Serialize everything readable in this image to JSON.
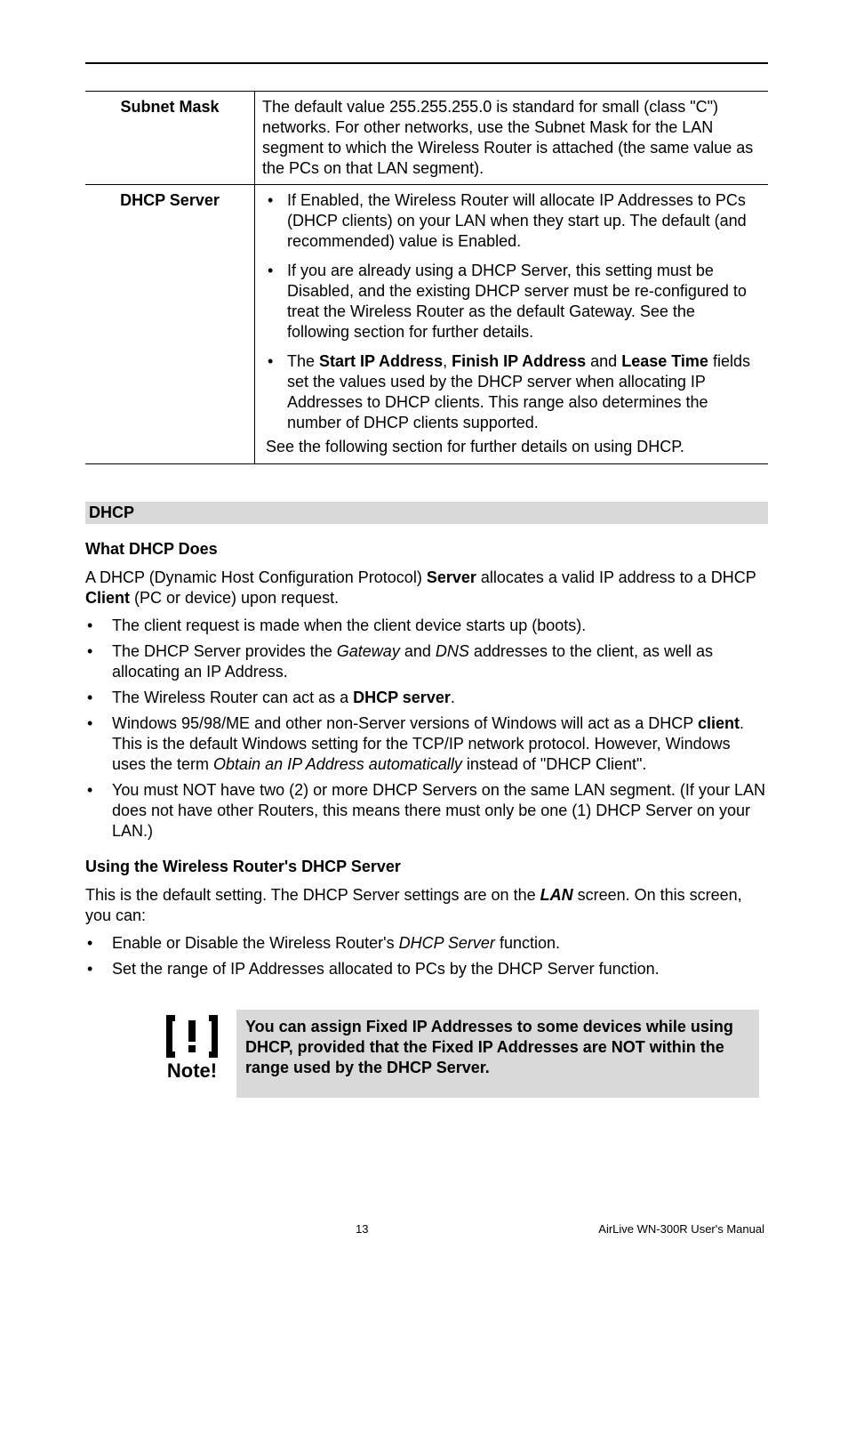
{
  "table": {
    "rows": [
      {
        "label": "Subnet Mask",
        "plain": "The default value 255.255.255.0 is standard for small (class \"C\") networks. For other networks, use the Subnet Mask for the LAN segment to which the Wireless Router is attached (the same value as the PCs on that LAN segment)."
      },
      {
        "label": "DHCP Server",
        "bullets": [
          "If Enabled, the Wireless Router will allocate IP Addresses to PCs (DHCP clients) on your LAN when they start up. The default (and recommended) value is Enabled.",
          "If you are already using a DHCP Server, this setting must be Disabled, and the existing DHCP server must be re-configured to treat the Wireless Router as the default Gateway. See the following section for further details.",
          {
            "pre": "The ",
            "b1": "Start IP Address",
            "mid1": ", ",
            "b2": "Finish IP Address",
            "mid2": " and ",
            "b3": "Lease Time",
            "post": " fields set the values used by the DHCP server when allocating IP Addresses to DHCP clients. This range also determines the number of DHCP clients supported."
          }
        ],
        "tail": "See the following section for further details on using DHCP."
      }
    ]
  },
  "dhcp": {
    "bar": "DHCP",
    "what_h": "What DHCP Does",
    "what_p_pre": "A DHCP (Dynamic Host Configuration Protocol) ",
    "what_p_b1": "Server",
    "what_p_mid": " allocates a valid IP address to a DHCP ",
    "what_p_b2": "Client",
    "what_p_post": " (PC or device) upon request.",
    "list1": [
      {
        "text": "The client request is made when the client device starts up (boots)."
      },
      {
        "pre": "The DHCP Server provides the ",
        "i1": "Gateway",
        "mid": " and ",
        "i2": "DNS",
        "post": " addresses to the client, as well as allocating an IP Address."
      },
      {
        "pre": "The Wireless Router can act as a ",
        "b": "DHCP server",
        "post": "."
      },
      {
        "pre": "Windows 95/98/ME and other non-Server versions of Windows will act as a DHCP ",
        "b": "client",
        "mid": ". This is the default Windows setting for the TCP/IP network protocol. However, Windows uses the term ",
        "i": "Obtain an IP Address automatically",
        "post": " instead of \"DHCP Client\"."
      },
      {
        "text": "You must NOT have two (2) or more DHCP Servers on the same LAN segment. (If your LAN does not have other Routers, this means there must only be one (1) DHCP Server on your LAN.)"
      }
    ],
    "using_h": "Using the Wireless Router's DHCP Server",
    "using_p_pre": "This is the default setting. The DHCP Server settings are on the ",
    "using_p_bi": "LAN",
    "using_p_post": " screen. On this screen, you can:",
    "list2": [
      {
        "pre": "Enable or Disable the Wireless Router's ",
        "i": "DHCP Server",
        "post": " function."
      },
      {
        "text": "Set the range of IP Addresses allocated to PCs by the DHCP Server function."
      }
    ]
  },
  "note": {
    "label": "Note!",
    "text": "You can assign Fixed IP Addresses to some devices while using DHCP, provided that the Fixed IP Addresses are NOT within the range used by the DHCP Server."
  },
  "footer": {
    "page": "13",
    "manual": "AirLive WN-300R User's Manual"
  }
}
